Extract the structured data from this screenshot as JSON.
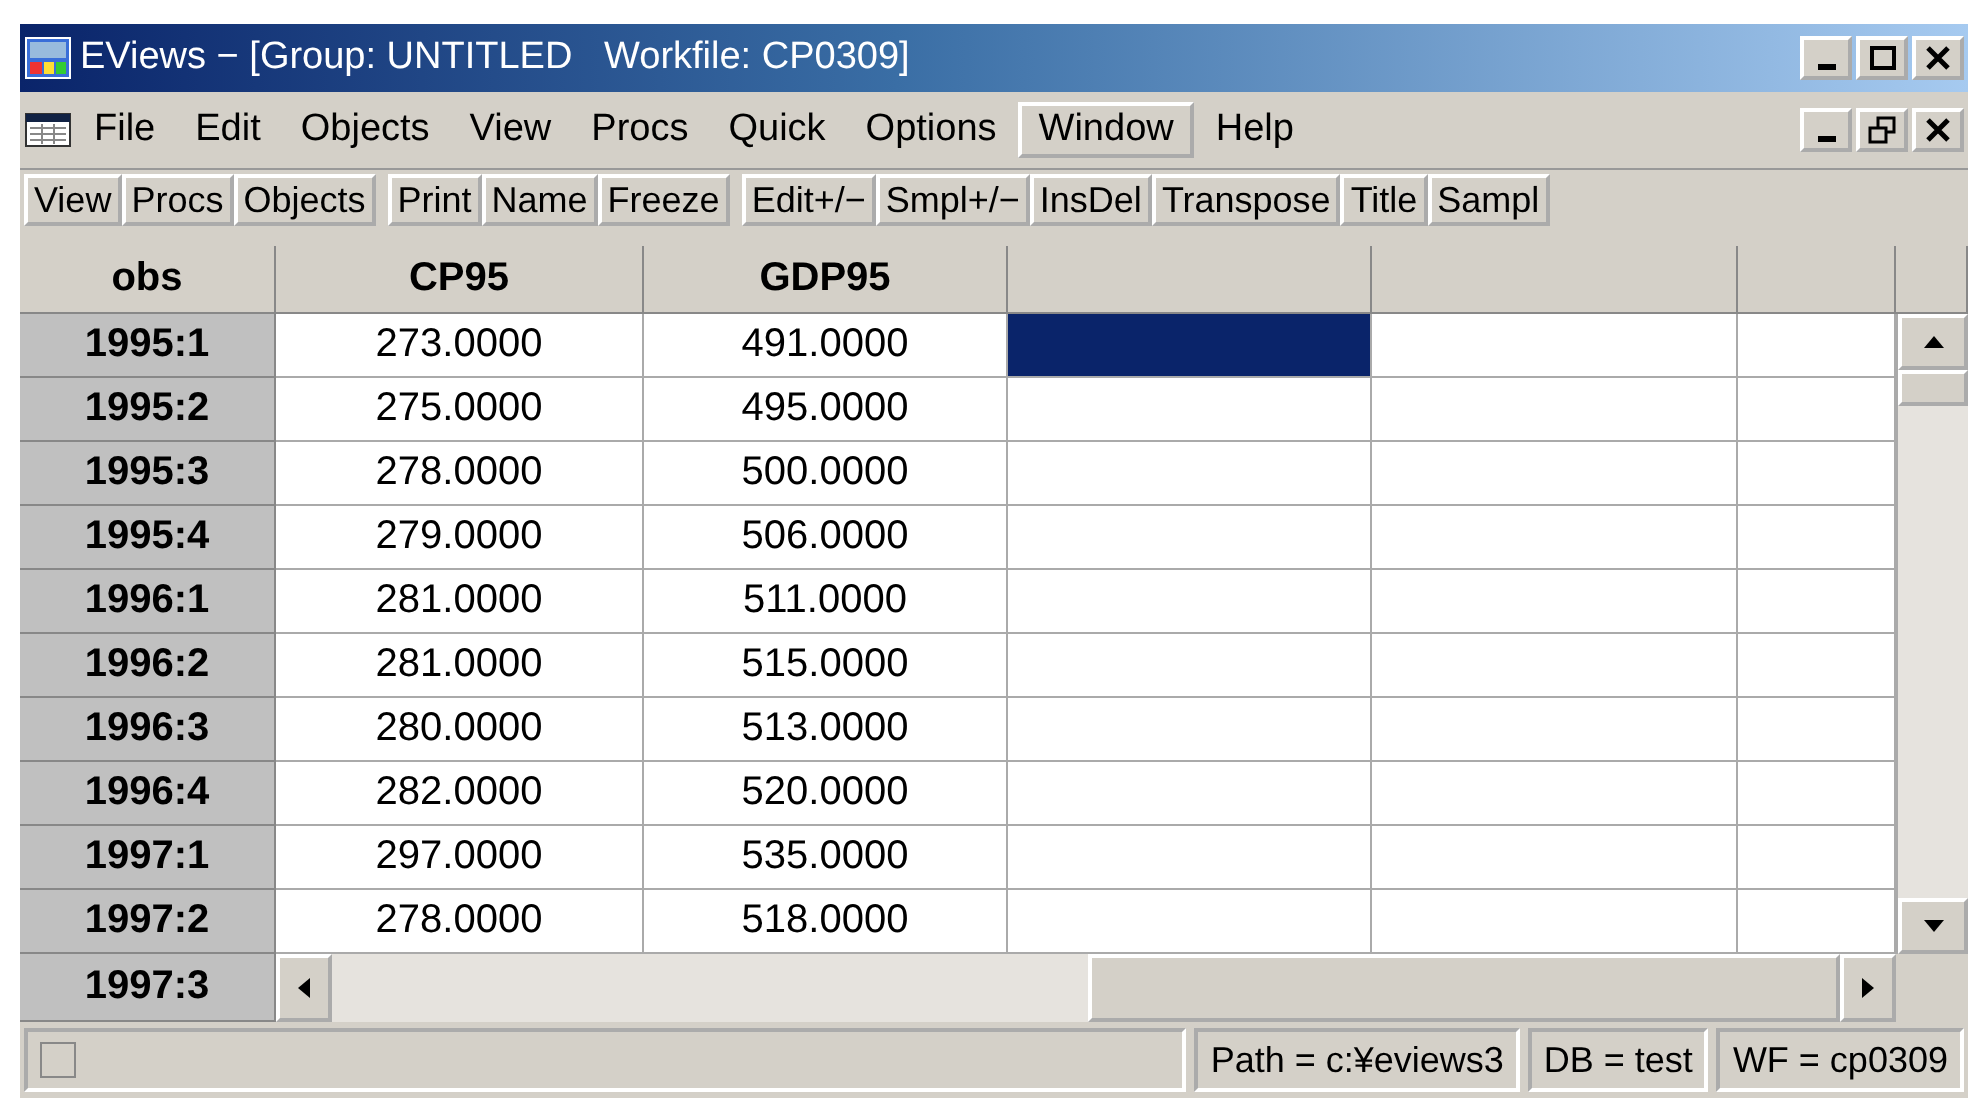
{
  "window": {
    "title": "EViews − [Group: UNTITLED   Workfile: CP0309]"
  },
  "menu": [
    {
      "label": "File",
      "selected": false
    },
    {
      "label": "Edit",
      "selected": false
    },
    {
      "label": "Objects",
      "selected": false
    },
    {
      "label": "View",
      "selected": false
    },
    {
      "label": "Procs",
      "selected": false
    },
    {
      "label": "Quick",
      "selected": false
    },
    {
      "label": "Options",
      "selected": false
    },
    {
      "label": "Window",
      "selected": true
    },
    {
      "label": "Help",
      "selected": false
    }
  ],
  "toolbar": [
    [
      "View",
      "Procs",
      "Objects"
    ],
    [
      "Print",
      "Name",
      "Freeze"
    ],
    [
      "Edit+/−",
      "Smpl+/−",
      "InsDel",
      "Transpose",
      "Title",
      "Sampl"
    ]
  ],
  "table": {
    "columns": [
      "obs",
      "CP95",
      "GDP95"
    ],
    "rows": [
      {
        "obs": "1995:1",
        "values": [
          "273.0000",
          "491.0000"
        ],
        "selected": true
      },
      {
        "obs": "1995:2",
        "values": [
          "275.0000",
          "495.0000"
        ],
        "selected": false
      },
      {
        "obs": "1995:3",
        "values": [
          "278.0000",
          "500.0000"
        ],
        "selected": false
      },
      {
        "obs": "1995:4",
        "values": [
          "279.0000",
          "506.0000"
        ],
        "selected": false
      },
      {
        "obs": "1996:1",
        "values": [
          "281.0000",
          "511.0000"
        ],
        "selected": false
      },
      {
        "obs": "1996:2",
        "values": [
          "281.0000",
          "515.0000"
        ],
        "selected": false
      },
      {
        "obs": "1996:3",
        "values": [
          "280.0000",
          "513.0000"
        ],
        "selected": false
      },
      {
        "obs": "1996:4",
        "values": [
          "282.0000",
          "520.0000"
        ],
        "selected": false
      },
      {
        "obs": "1997:1",
        "values": [
          "297.0000",
          "535.0000"
        ],
        "selected": false
      },
      {
        "obs": "1997:2",
        "values": [
          "278.0000",
          "518.0000"
        ],
        "selected": false
      }
    ],
    "last_row": {
      "obs": "1997:3"
    }
  },
  "status_bar": [
    "Path = c:¥eviews3",
    "DB = test",
    "WF = cp0309"
  ]
}
